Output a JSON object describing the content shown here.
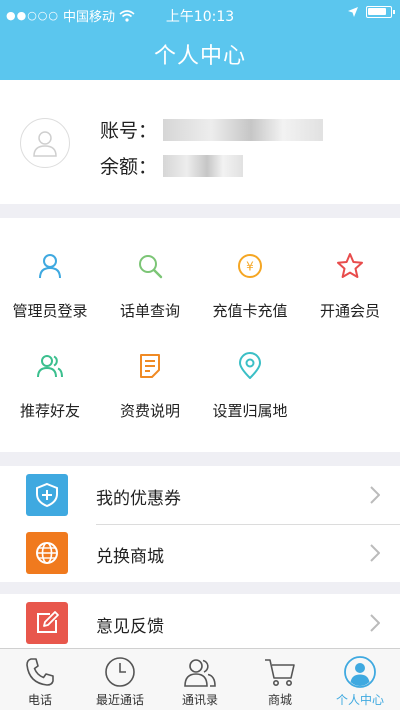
{
  "status_bar": {
    "carrier": "中国移动",
    "time": "上午10:13"
  },
  "nav": {
    "title": "个人中心"
  },
  "profile": {
    "account_label": "账号：",
    "balance_label": "余额："
  },
  "grid": {
    "items": [
      {
        "label": "管理员登录",
        "icon": "admin-user-icon",
        "color": "#3fa9e0"
      },
      {
        "label": "话单查询",
        "icon": "search-icon",
        "color": "#7cc576"
      },
      {
        "label": "充值卡充值",
        "icon": "yuan-coin-icon",
        "color": "#f5a623"
      },
      {
        "label": "开通会员",
        "icon": "star-icon",
        "color": "#e84c4c"
      },
      {
        "label": "推荐好友",
        "icon": "friends-icon",
        "color": "#3bbf8e"
      },
      {
        "label": "资费说明",
        "icon": "document-icon",
        "color": "#f08a24"
      },
      {
        "label": "设置归属地",
        "icon": "location-pin-icon",
        "color": "#3bbfc6"
      }
    ]
  },
  "list": {
    "group1": [
      {
        "label": "我的优惠券",
        "icon": "coupon-shield-icon",
        "color": "#3fa9e0"
      },
      {
        "label": "兑换商城",
        "icon": "globe-icon",
        "color": "#f07a1e"
      }
    ],
    "group2": [
      {
        "label": "意见反馈",
        "icon": "edit-feedback-icon",
        "color": "#e8574c"
      }
    ]
  },
  "tabbar": {
    "tabs": [
      {
        "label": "电话",
        "icon": "phone-icon",
        "active": false
      },
      {
        "label": "最近通话",
        "icon": "clock-icon",
        "active": false
      },
      {
        "label": "通讯录",
        "icon": "contacts-icon",
        "active": false
      },
      {
        "label": "商城",
        "icon": "cart-icon",
        "active": false
      },
      {
        "label": "个人中心",
        "icon": "profile-icon",
        "active": true
      }
    ],
    "active_color": "#3fa9e0"
  }
}
